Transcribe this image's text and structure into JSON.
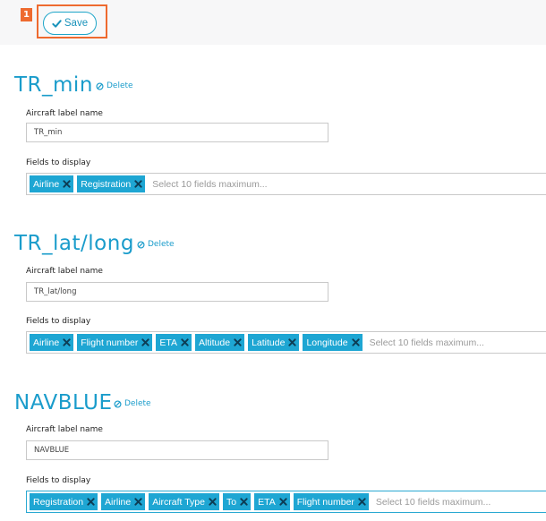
{
  "toolbar": {
    "step_number": "1",
    "save_label": "Save"
  },
  "sections": [
    {
      "title": "TR_min",
      "delete_label": "Delete",
      "name_label": "Aircraft label name",
      "name_value": "TR_min",
      "fields_label": "Fields to display",
      "tags": [
        "Airline",
        "Registration"
      ],
      "placeholder": "Select 10 fields maximum..."
    },
    {
      "title": "TR_lat/long",
      "delete_label": "Delete",
      "name_label": "Aircraft label name",
      "name_value": "TR_lat/long",
      "fields_label": "Fields to display",
      "tags": [
        "Airline",
        "Flight number",
        "ETA",
        "Altitude",
        "Latitude",
        "Longitude"
      ],
      "placeholder": "Select 10 fields maximum..."
    },
    {
      "title": "NAVBLUE",
      "delete_label": "Delete",
      "name_label": "Aircraft label name",
      "name_value": "NAVBLUE",
      "fields_label": "Fields to display",
      "tags": [
        "Registration",
        "Airline",
        "Aircraft Type",
        "To",
        "ETA",
        "Flight number"
      ],
      "placeholder": "Select 10 fields maximum..."
    }
  ],
  "icons": {
    "save": "check-icon",
    "delete": "ban-icon",
    "remove_tag": "close-icon"
  },
  "colors": {
    "accent": "#1a9ccb",
    "tag_bg": "#1ea6d3",
    "highlight": "#ee6a2f"
  }
}
